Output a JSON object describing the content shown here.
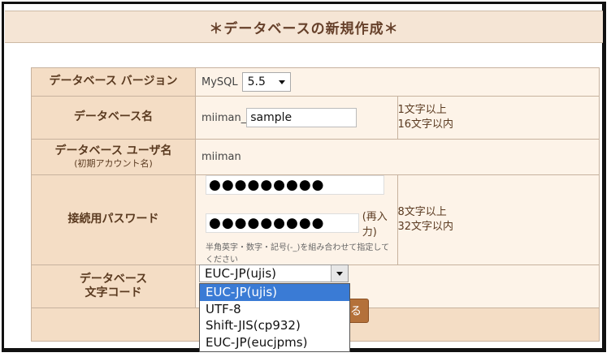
{
  "page": {
    "title": "＊データベースの新規作成＊"
  },
  "form": {
    "version": {
      "label": "データベース バージョン",
      "prefix": "MySQL",
      "selected": "5.5"
    },
    "db_name": {
      "label": "データベース名",
      "prefix": "miiman_",
      "value": "sample",
      "note_line1": "1文字以上",
      "note_line2": "16文字以内"
    },
    "db_user": {
      "label": "データベース ユーザ名",
      "sublabel": "(初期アカウント名)",
      "value": "miiman"
    },
    "password": {
      "label": "接続用パスワード",
      "value": "●●●●●●●●●",
      "confirm_value": "●●●●●●●●●",
      "reenter_label": "(再入力)",
      "hint": "半角英字・数字・記号(-_)を組み合わせて指定してください",
      "note_line1": "8文字以上",
      "note_line2": "32文字以内"
    },
    "charset": {
      "label_line1": "データベース",
      "label_line2": "文字コード",
      "selected": "EUC-JP(ujis)",
      "options": [
        "EUC-JP(ujis)",
        "UTF-8",
        "Shift-JIS(cp932)",
        "EUC-JP(eucjpms)"
      ]
    },
    "submit": {
      "label_visible": "る"
    }
  },
  "icons": {
    "dropdown": "chevron-down-icon"
  },
  "colors": {
    "label_bg": "#f4ddc5",
    "value_bg": "#fdf3e8",
    "highlight": "#3a7bd5",
    "button": "#b4713a"
  }
}
